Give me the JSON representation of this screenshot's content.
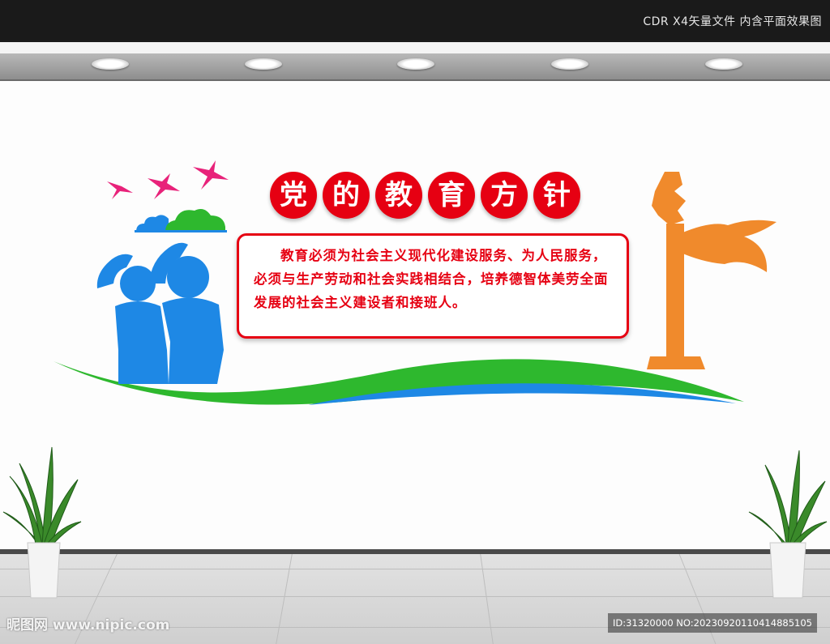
{
  "header": {
    "label": "CDR X4矢量文件  内含平面效果图"
  },
  "title": {
    "chars": [
      "党",
      "的",
      "教",
      "育",
      "方",
      "针"
    ]
  },
  "body": {
    "text": "教育必须为社会主义现代化建设服务、为人民服务，必须与生产劳动和社会实践相结合，培养德智体美劳全面发展的社会主义建设者和接班人。"
  },
  "watermark": {
    "left": "昵图网 www.nipic.com",
    "right": "ID:31320000 NO:20230920110414885105"
  },
  "colors": {
    "accent_red": "#e60012",
    "figure_blue": "#1e88e5",
    "wave_green": "#2eb82e",
    "pillar_orange": "#f08a2c",
    "bird_pink": "#e8227a"
  }
}
